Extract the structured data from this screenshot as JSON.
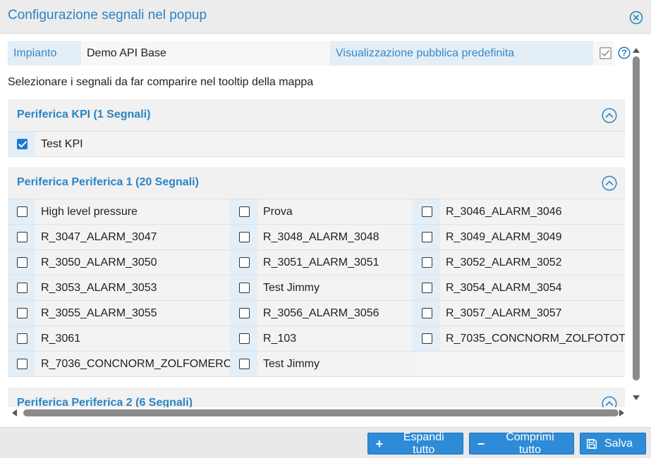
{
  "dialog": {
    "title": "Configurazione segnali nel popup"
  },
  "info": {
    "impianto_label": "Impianto",
    "impianto_value": "Demo API Base",
    "public_label": "Visualizzazione pubblica predefinita",
    "public_checked": true
  },
  "subtitle": "Selezionare i segnali da far comparire nel tooltip della mappa",
  "sections": [
    {
      "title": "Periferica KPI (1 Segnali)",
      "signals": [
        {
          "label": "Test KPI",
          "checked": true
        }
      ]
    },
    {
      "title": "Periferica Periferica 1 (20 Segnali)",
      "signals": [
        {
          "label": "High level pressure",
          "checked": false
        },
        {
          "label": "Prova",
          "checked": false
        },
        {
          "label": "R_3046_ALARM_3046",
          "checked": false
        },
        {
          "label": "R_3047_ALARM_3047",
          "checked": false
        },
        {
          "label": "R_3048_ALARM_3048",
          "checked": false
        },
        {
          "label": "R_3049_ALARM_3049",
          "checked": false
        },
        {
          "label": "R_3050_ALARM_3050",
          "checked": false
        },
        {
          "label": "R_3051_ALARM_3051",
          "checked": false
        },
        {
          "label": "R_3052_ALARM_3052",
          "checked": false
        },
        {
          "label": "R_3053_ALARM_3053",
          "checked": false
        },
        {
          "label": "Test Jimmy",
          "checked": false
        },
        {
          "label": "R_3054_ALARM_3054",
          "checked": false
        },
        {
          "label": "R_3055_ALARM_3055",
          "checked": false
        },
        {
          "label": "R_3056_ALARM_3056",
          "checked": false
        },
        {
          "label": "R_3057_ALARM_3057",
          "checked": false
        },
        {
          "label": "R_3061",
          "checked": false
        },
        {
          "label": "R_103",
          "checked": false
        },
        {
          "label": "R_7035_CONCNORM_ZOLFOTOT",
          "checked": false
        },
        {
          "label": "R_7036_CONCNORM_ZOLFOMERC",
          "checked": false
        },
        {
          "label": "Test Jimmy",
          "checked": false
        }
      ]
    },
    {
      "title": "Periferica Periferica 2 (6 Segnali)",
      "signals": []
    }
  ],
  "footer": {
    "expand_label": "Espandi tutto",
    "collapse_label": "Comprimi tutto",
    "save_label": "Salva"
  },
  "colors": {
    "accent": "#2a84c6",
    "button": "#2e8bd8",
    "checkbox_checked": "#2079d0"
  }
}
